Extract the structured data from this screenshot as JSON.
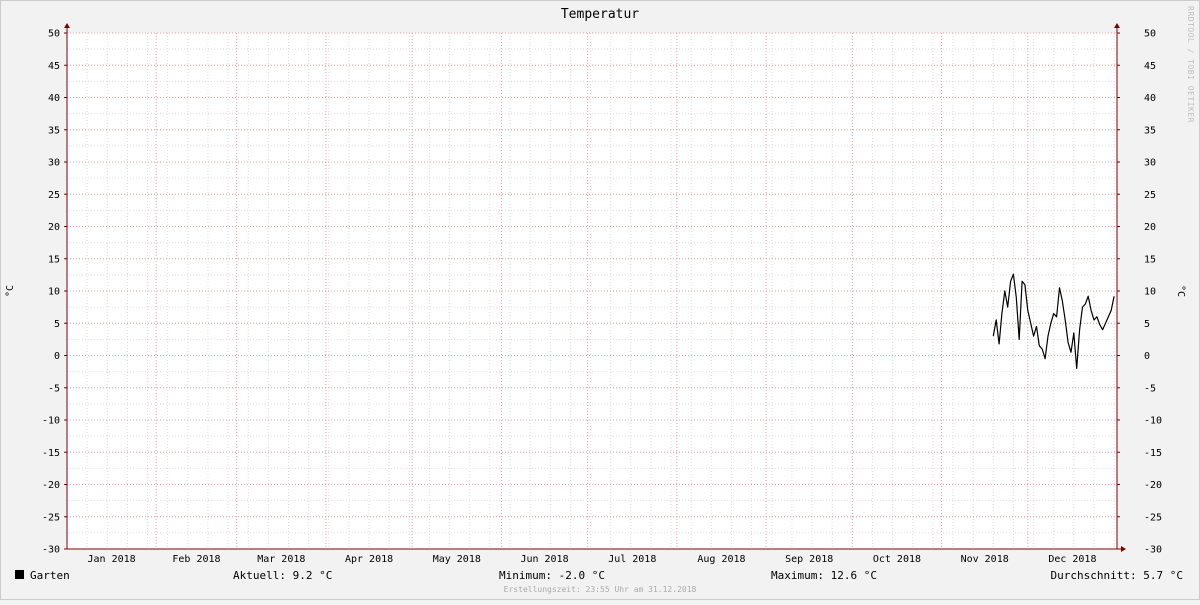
{
  "chart_data": {
    "type": "line",
    "title": "Temperatur",
    "ylabel": "°C",
    "ylim": [
      -30,
      50
    ],
    "y_ticks": [
      50,
      45,
      40,
      35,
      30,
      25,
      20,
      15,
      10,
      5,
      0,
      -5,
      -10,
      -15,
      -20,
      -25,
      -30
    ],
    "x_domain": [
      "2018-01-01",
      "2019-01-01"
    ],
    "x_tick_labels": [
      "Jan 2018",
      "Feb 2018",
      "Mar 2018",
      "Apr 2018",
      "May 2018",
      "Jun 2018",
      "Jul 2018",
      "Aug 2018",
      "Sep 2018",
      "Oct 2018",
      "Nov 2018",
      "Dec 2018"
    ],
    "month_starts": [
      "2018-01-01",
      "2018-02-01",
      "2018-03-01",
      "2018-04-01",
      "2018-05-01",
      "2018-06-01",
      "2018-07-01",
      "2018-08-01",
      "2018-09-01",
      "2018-10-01",
      "2018-11-01",
      "2018-12-01"
    ],
    "grid": true,
    "series": [
      {
        "name": "Garten",
        "color": "#000000",
        "x": [
          "2018-11-19",
          "2018-11-20",
          "2018-11-21",
          "2018-11-22",
          "2018-11-23",
          "2018-11-24",
          "2018-11-25",
          "2018-11-26",
          "2018-11-27",
          "2018-11-28",
          "2018-11-29",
          "2018-11-30",
          "2018-12-01",
          "2018-12-02",
          "2018-12-03",
          "2018-12-04",
          "2018-12-05",
          "2018-12-06",
          "2018-12-07",
          "2018-12-08",
          "2018-12-09",
          "2018-12-10",
          "2018-12-11",
          "2018-12-12",
          "2018-12-13",
          "2018-12-14",
          "2018-12-15",
          "2018-12-16",
          "2018-12-17",
          "2018-12-18",
          "2018-12-19",
          "2018-12-20",
          "2018-12-21",
          "2018-12-22",
          "2018-12-23",
          "2018-12-24",
          "2018-12-25",
          "2018-12-26",
          "2018-12-27",
          "2018-12-28",
          "2018-12-29",
          "2018-12-30",
          "2018-12-31"
        ],
        "values": [
          3.0,
          5.5,
          1.8,
          6.5,
          10.0,
          7.5,
          11.5,
          12.6,
          9.0,
          2.5,
          11.5,
          11.0,
          7.0,
          5.0,
          3.0,
          4.5,
          1.5,
          1.0,
          -0.5,
          3.0,
          5.0,
          6.5,
          6.0,
          10.5,
          8.5,
          5.5,
          2.0,
          0.5,
          3.5,
          -2.0,
          4.0,
          7.5,
          8.0,
          9.2,
          7.0,
          5.5,
          6.0,
          4.8,
          4.0,
          5.0,
          6.0,
          7.0,
          9.2
        ]
      }
    ]
  },
  "legend": {
    "series_name": "Garten",
    "current": "Aktuell: 9.2 °C",
    "minimum": "Minimum: -2.0 °C",
    "maximum": "Maximum: 12.6 °C",
    "average": "Durchschnitt: 5.7 °C"
  },
  "footer": "Erstellungszeit: 23:55 Uhr am 31.12.2018",
  "watermark": "RRDTOOL / TOBI OETIKER",
  "colors": {
    "background": "#f2f2f2",
    "plot_background": "#ffffff",
    "grid_minor": "#dddddd",
    "grid_major": "#e8a0a0",
    "axis": "#800000"
  }
}
